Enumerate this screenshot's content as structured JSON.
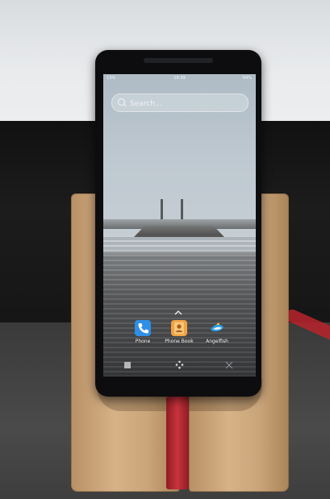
{
  "statusbar": {
    "left": "13%",
    "clock": "16:39",
    "right": "54%"
  },
  "search": {
    "placeholder": "Search..."
  },
  "dock": {
    "apps": [
      {
        "label": "Phone",
        "icon": "phone-icon"
      },
      {
        "label": "Phone Book",
        "icon": "contacts-icon"
      },
      {
        "label": "Angelfish",
        "icon": "angelfish-icon"
      }
    ]
  },
  "navbar": {
    "icons": [
      "task-switcher-icon",
      "home-icon",
      "close-icon"
    ]
  },
  "colors": {
    "phone_app": "#2d8fe6",
    "phone_book_app": "#f2a341",
    "angelfish_app": "#2a9be0"
  }
}
